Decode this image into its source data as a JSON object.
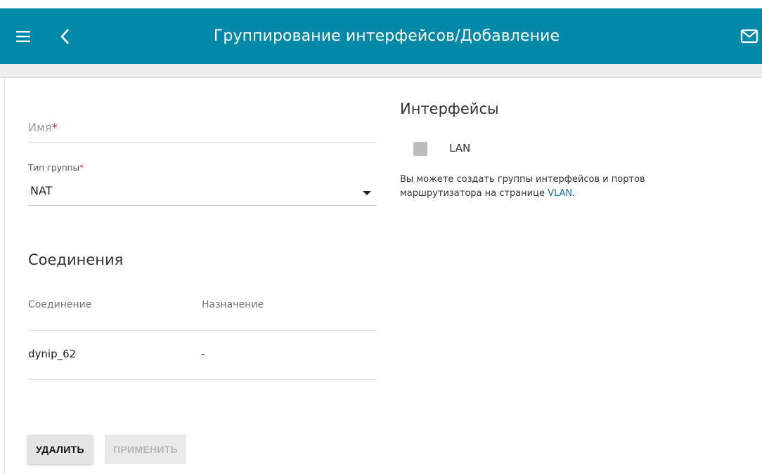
{
  "header": {
    "title": "Группирование интерфейсов/Добавление",
    "menu_icon": "hamburger-menu-icon",
    "back_icon": "chevron-left-icon",
    "mail_icon": "mail-icon",
    "background": "#0289a8"
  },
  "form": {
    "name_label": "Имя",
    "name_value": "",
    "required_mark": "*",
    "type_label": "Тип группы",
    "type_value": "NAT"
  },
  "connections": {
    "title": "Соединения",
    "columns": [
      "Соединение",
      "Назначение"
    ],
    "rows": [
      {
        "connection": "dynip_62",
        "destination": "-"
      }
    ]
  },
  "interfaces": {
    "title": "Интерфейсы",
    "items": [
      {
        "label": "LAN",
        "checked": false
      }
    ],
    "note_text": "Вы можете создать группы интерфейсов и портов маршрутизатора на странице ",
    "note_link": "VLAN",
    "note_end": "."
  },
  "buttons": {
    "delete": "УДАЛИТЬ",
    "apply": "ПРИМЕНИТЬ"
  }
}
